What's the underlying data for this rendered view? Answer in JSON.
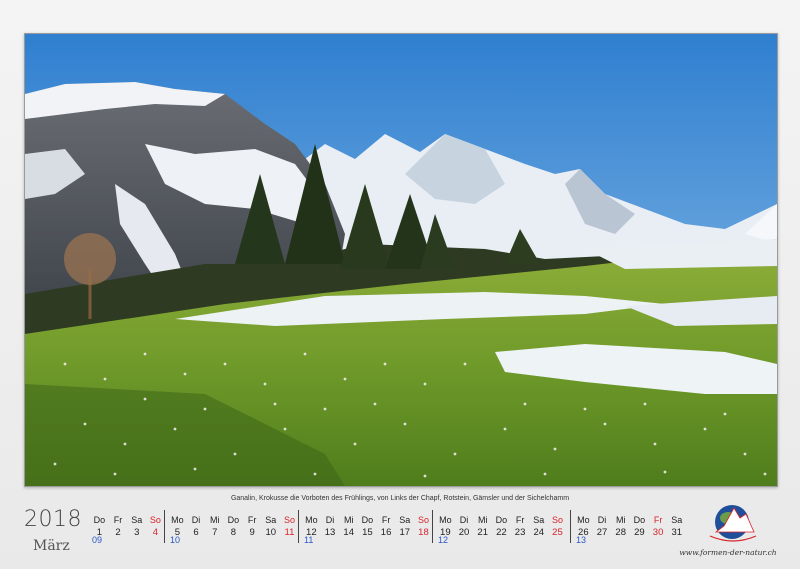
{
  "caption": "Ganalin, Krokusse die Vorboten des Frühlings, von Links der Chapf, Rotstein, Gämsler und der Sichelchamm",
  "year": "2018",
  "month": "März",
  "website": "www.formen-der-natur.ch",
  "colors": {
    "sunday": "#d8232a",
    "holiday": "#d8232a",
    "week_number": "#2a57c8"
  },
  "calendar": {
    "weeks": [
      {
        "kw": "09",
        "days": [
          {
            "n": "Do",
            "d": "1"
          },
          {
            "n": "Fr",
            "d": "2"
          },
          {
            "n": "Sa",
            "d": "3"
          },
          {
            "n": "So",
            "d": "4"
          }
        ]
      },
      {
        "kw": "10",
        "days": [
          {
            "n": "Mo",
            "d": "5"
          },
          {
            "n": "Di",
            "d": "6"
          },
          {
            "n": "Mi",
            "d": "7"
          },
          {
            "n": "Do",
            "d": "8"
          },
          {
            "n": "Fr",
            "d": "9"
          },
          {
            "n": "Sa",
            "d": "10"
          },
          {
            "n": "So",
            "d": "11"
          }
        ]
      },
      {
        "kw": "11",
        "days": [
          {
            "n": "Mo",
            "d": "12"
          },
          {
            "n": "Di",
            "d": "13"
          },
          {
            "n": "Mi",
            "d": "14"
          },
          {
            "n": "Do",
            "d": "15"
          },
          {
            "n": "Fr",
            "d": "16"
          },
          {
            "n": "Sa",
            "d": "17"
          },
          {
            "n": "So",
            "d": "18"
          }
        ]
      },
      {
        "kw": "12",
        "days": [
          {
            "n": "Mo",
            "d": "19"
          },
          {
            "n": "Di",
            "d": "20"
          },
          {
            "n": "Mi",
            "d": "21"
          },
          {
            "n": "Do",
            "d": "22"
          },
          {
            "n": "Fr",
            "d": "23"
          },
          {
            "n": "Sa",
            "d": "24"
          },
          {
            "n": "So",
            "d": "25"
          }
        ]
      },
      {
        "kw": "13",
        "days": [
          {
            "n": "Mo",
            "d": "26"
          },
          {
            "n": "Di",
            "d": "27"
          },
          {
            "n": "Mi",
            "d": "28"
          },
          {
            "n": "Do",
            "d": "29"
          },
          {
            "n": "Fr",
            "d": "30",
            "holiday": true
          },
          {
            "n": "Sa",
            "d": "31"
          }
        ]
      }
    ]
  }
}
